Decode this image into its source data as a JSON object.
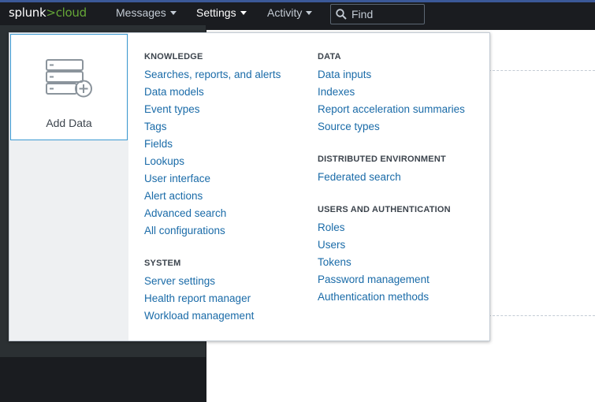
{
  "topbar": {
    "logo_main": "splunk",
    "logo_sep": ">",
    "logo_accent": "cloud",
    "nav": [
      {
        "label": "Messages"
      },
      {
        "label": "Settings"
      },
      {
        "label": "Activity"
      }
    ],
    "search_placeholder": "Find"
  },
  "menu": {
    "add_data_label": "Add Data",
    "knowledge": {
      "title": "KNOWLEDGE",
      "items": [
        "Searches, reports, and alerts",
        "Data models",
        "Event types",
        "Tags",
        "Fields",
        "Lookups",
        "User interface",
        "Alert actions",
        "Advanced search",
        "All configurations"
      ]
    },
    "system": {
      "title": "SYSTEM",
      "items": [
        "Server settings",
        "Health report manager",
        "Workload management"
      ]
    },
    "data": {
      "title": "DATA",
      "items": [
        "Data inputs",
        "Indexes",
        "Report acceleration summaries",
        "Source types"
      ]
    },
    "distributed": {
      "title": "DISTRIBUTED ENVIRONMENT",
      "items": [
        "Federated search"
      ]
    },
    "users": {
      "title": "USERS AND AUTHENTICATION",
      "items": [
        "Roles",
        "Users",
        "Tokens",
        "Password management",
        "Authentication methods"
      ]
    }
  }
}
